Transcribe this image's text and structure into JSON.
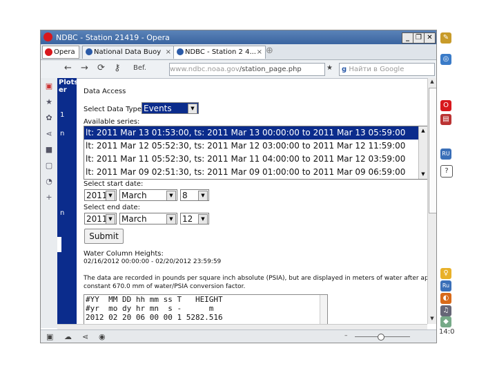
{
  "window": {
    "title": "NDBC - Station 21419 - Opera",
    "buttons": {
      "minimize": "_",
      "maximize": "❐",
      "close": "✕"
    }
  },
  "tabs": {
    "menu_label": "Opera",
    "items": [
      {
        "label": "National Data Buoy",
        "close": "×"
      },
      {
        "label": "NDBC - Station 2 4...",
        "close": "×"
      }
    ],
    "add": "⊕"
  },
  "navbar": {
    "back": "←",
    "forward": "→",
    "reload": "⟳",
    "key": "⚷",
    "security_label": "Bef.",
    "url_host": "www.ndbc.noaa.gov",
    "url_path": "/station_page.php",
    "search_placeholder": "Найти в Google"
  },
  "left_panel": {
    "text": "Plots er",
    "marks": [
      "1",
      "n",
      "n"
    ]
  },
  "page": {
    "heading": "Data Access",
    "data_type_label": "Select Data Type:",
    "data_type_value": "Events",
    "series_label": "Available series:",
    "series": [
      "lt: 2011 Mar 13 01:53:00, ts: 2011 Mar 13 00:00:00 to 2011 Mar 13 05:59:00",
      "lt: 2011 Mar 12 05:52:30, ts: 2011 Mar 12 03:00:00 to 2011 Mar 12 11:59:00",
      "lt: 2011 Mar 11 05:52:30, ts: 2011 Mar 11 04:00:00 to 2011 Mar 12 03:59:00",
      "lt: 2011 Mar 09 02:51:30, ts: 2011 Mar 09 01:00:00 to 2011 Mar 09 06:59:00"
    ],
    "start_label": "Select start date:",
    "start": {
      "year": "2011",
      "month": "March",
      "day": "8"
    },
    "end_label": "Select end date:",
    "end": {
      "year": "2011",
      "month": "March",
      "day": "12"
    },
    "submit_label": "Submit",
    "wch_label": "Water Column Heights:",
    "wch_range": "02/16/2012 00:00:00 - 02/20/2012 23:59:59",
    "note_line1": "The data are recorded in pounds per square inch absolute (PSIA), but are displayed in meters of water after app",
    "note_line2": "constant 670.0 mm of water/PSIA conversion factor.",
    "data_lines": [
      "#YY  MM DD hh mm ss T   HEIGHT",
      "#yr  mo dy hr mn  s -      m",
      "2012 02 20 06 00 00 1 5282.516"
    ]
  },
  "tray": {
    "clock": "14:0"
  }
}
